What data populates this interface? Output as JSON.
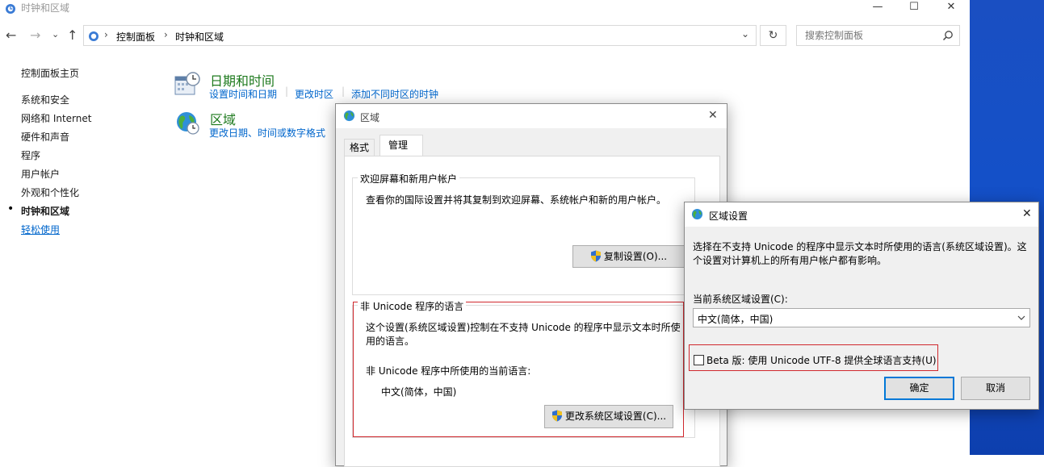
{
  "window": {
    "title": "时钟和区域",
    "minimize": "—",
    "maximize": "☐",
    "close": "✕"
  },
  "nav": {
    "back": "←",
    "forward": "→",
    "dropdown": "⌄",
    "up": "↑",
    "breadcrumb": [
      "控制面板",
      "时钟和区域"
    ],
    "separator": "›",
    "address_dropdown": "⌄",
    "refresh": "↻",
    "search_placeholder": "搜索控制面板",
    "search_icon": "search-icon"
  },
  "sidebar": {
    "home": "控制面板主页",
    "items": [
      {
        "label": "系统和安全"
      },
      {
        "label": "网络和 Internet"
      },
      {
        "label": "硬件和声音"
      },
      {
        "label": "程序"
      },
      {
        "label": "用户帐户"
      },
      {
        "label": "外观和个性化"
      },
      {
        "label": "时钟和区域",
        "current": true
      },
      {
        "label": "轻松使用"
      }
    ],
    "bullet": "•"
  },
  "categories": [
    {
      "title": "日期和时间",
      "icon": "calendar-clock-icon",
      "links": [
        "设置时间和日期",
        "更改时区",
        "添加不同时区的时钟"
      ]
    },
    {
      "title": "区域",
      "icon": "globe-clock-icon",
      "links": [
        "更改日期、时间或数字格式"
      ]
    }
  ],
  "region_dialog": {
    "title": "区域",
    "close": "✕",
    "tabs": [
      "格式",
      "管理"
    ],
    "active_tab": "管理",
    "welcome_group": {
      "label": "欢迎屏幕和新用户帐户",
      "text": "查看你的国际设置并将其复制到欢迎屏幕、系统帐户和新的用户帐户。",
      "button": "复制设置(O)..."
    },
    "unicode_group": {
      "label": "非 Unicode 程序的语言",
      "text": "这个设置(系统区域设置)控制在不支持 Unicode 的程序中显示文本时所使用的语言。",
      "current_label": "非 Unicode 程序中所使用的当前语言:",
      "current_value": "中文(简体，中国)",
      "button": "更改系统区域设置(C)..."
    }
  },
  "locale_dialog": {
    "title": "区域设置",
    "close": "✕",
    "description": "选择在不支持 Unicode 的程序中显示文本时所使用的语言(系统区域设置)。这个设置对计算机上的所有用户帐户都有影响。",
    "current_label": "当前系统区域设置(C):",
    "current_value": "中文(简体，中国)",
    "beta_checkbox": {
      "label": "Beta 版: 使用 Unicode UTF-8 提供全球语言支持(U)",
      "checked": false
    },
    "ok": "确定",
    "cancel": "取消"
  },
  "colors": {
    "highlight_box": "#d0282e",
    "link": "#0066cc",
    "category_title": "#1e7a1e",
    "default_button_border": "#0078d7"
  }
}
